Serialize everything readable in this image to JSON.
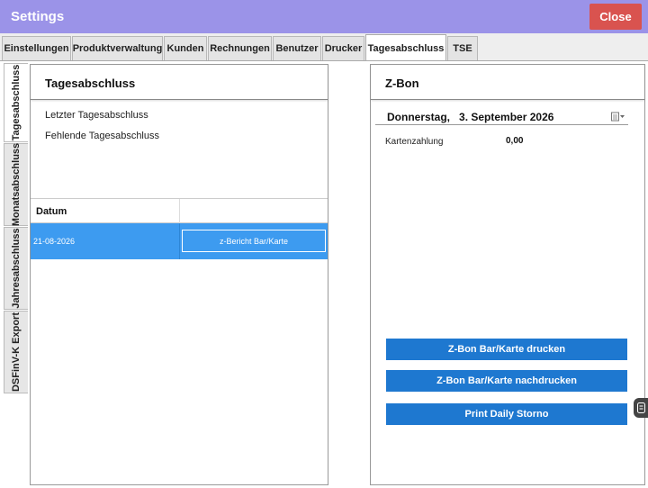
{
  "window": {
    "title": "Settings",
    "close_label": "Close",
    "colors": {
      "titlebar": "#9b93e8",
      "close": "#d9534f",
      "accent": "#1e78d0",
      "selection": "#3d9bf0"
    }
  },
  "tabs": [
    {
      "label": "Einstellungen"
    },
    {
      "label": "Produktverwaltung"
    },
    {
      "label": "Kunden"
    },
    {
      "label": "Rechnungen"
    },
    {
      "label": "Benutzer"
    },
    {
      "label": "Drucker"
    },
    {
      "label": "Tagesabschluss",
      "active": true
    },
    {
      "label": "TSE"
    }
  ],
  "side_tabs": [
    {
      "label": "Tagesabschluss",
      "active": true
    },
    {
      "label": "Monatsabschluss"
    },
    {
      "label": "Jahresabschluss"
    },
    {
      "label": "DSFinV-K Export"
    }
  ],
  "left_panel": {
    "title": "Tagesabschluss",
    "last_closing_label": "Letzter Tagesabschluss",
    "missing_closing_label": "Fehlende Tagesabschluss",
    "table": {
      "columns": [
        "Datum",
        ""
      ],
      "rows": [
        {
          "date": "21-08-2026",
          "action_label": "z-Bericht Bar/Karte",
          "selected": true
        }
      ]
    }
  },
  "right_panel": {
    "title": "Z-Bon",
    "date_weekday": "Donnerstag,",
    "date_text": "3. September 2026",
    "calendar_icon": "calendar-icon",
    "card_payment_label": "Kartenzahlung",
    "card_payment_value": "0,00",
    "buttons": {
      "print": "Z-Bon Bar/Karte drucken",
      "reprint": "Z-Bon Bar/Karte nachdrucken",
      "storno": "Print Daily Storno"
    }
  }
}
